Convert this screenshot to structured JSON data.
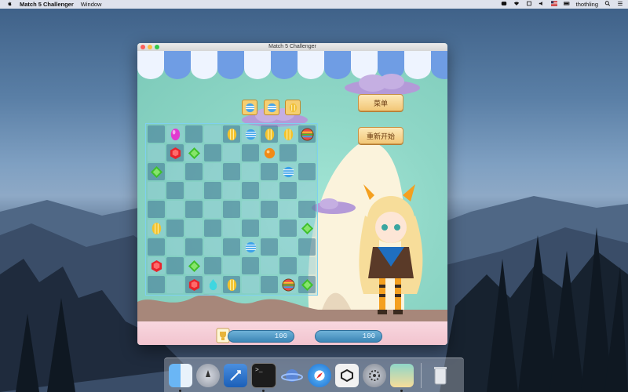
{
  "menubar": {
    "apple": "",
    "app_name": "Match 5 Challenger",
    "menus": [
      "Window"
    ],
    "user": "thothling"
  },
  "window": {
    "title": "Match 5 Challenger"
  },
  "game": {
    "menu_button": "菜单",
    "restart_button": "重新开始",
    "goals": [
      "blue-striped",
      "blue-striped",
      "yellow-egg"
    ],
    "score_left": "100",
    "score_right": "100",
    "board": [
      [
        "empty",
        "magenta",
        "empty",
        "empty",
        "yellow",
        "blue-stripe",
        "yellow",
        "yellow",
        "rainbow"
      ],
      [
        "empty",
        "red",
        "green",
        "empty",
        "empty",
        "empty",
        "orange",
        "empty",
        "empty"
      ],
      [
        "green",
        "empty",
        "empty",
        "empty",
        "empty",
        "empty",
        "empty",
        "blue-stripe",
        "empty"
      ],
      [
        "empty",
        "empty",
        "empty",
        "empty",
        "empty",
        "empty",
        "empty",
        "empty",
        "empty"
      ],
      [
        "empty",
        "empty",
        "empty",
        "empty",
        "empty",
        "empty",
        "empty",
        "empty",
        "empty"
      ],
      [
        "yellow",
        "empty",
        "empty",
        "empty",
        "empty",
        "empty",
        "empty",
        "empty",
        "green"
      ],
      [
        "empty",
        "empty",
        "empty",
        "empty",
        "empty",
        "blue-stripe",
        "empty",
        "empty",
        "empty"
      ],
      [
        "red",
        "empty",
        "green",
        "empty",
        "empty",
        "empty",
        "empty",
        "empty",
        "empty"
      ],
      [
        "empty",
        "empty",
        "red",
        "cyan",
        "yellow",
        "empty",
        "empty",
        "rainbow",
        "green"
      ]
    ]
  },
  "dock": {
    "items": [
      "finder-icon",
      "launchpad-icon",
      "xcode-icon",
      "terminal-icon",
      "network-icon",
      "safari-icon",
      "unity-icon",
      "system-preferences-icon",
      "game-app-icon",
      "trash-icon"
    ]
  },
  "colors": {
    "accent": "#f2c777",
    "board_cell": "#46789a",
    "score_pill": "#3c86b6"
  }
}
